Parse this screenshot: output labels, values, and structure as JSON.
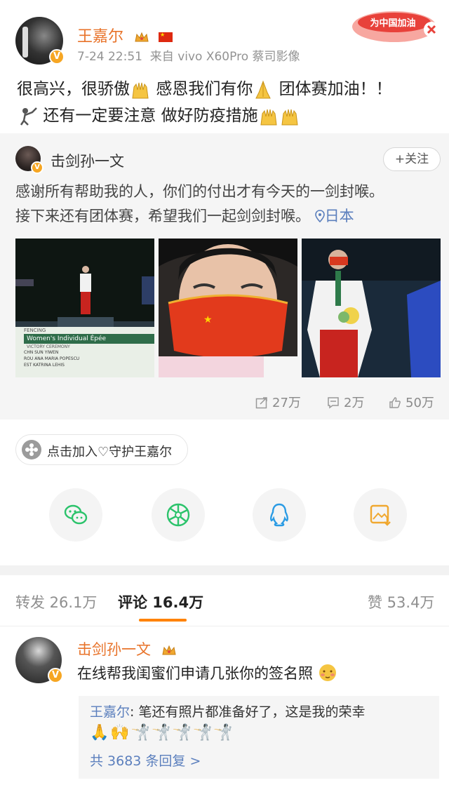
{
  "post": {
    "author": "王嘉尔",
    "time": "7-24 22:51",
    "source": "来自 vivo X60Pro 蔡司影像",
    "text_line1": "很高兴，很骄傲",
    "text_line1b": "感恩我们有你",
    "text_line1c": "团体赛加油！！",
    "text_line2": "还有一定要注意 做好防疫措施",
    "sticker_text": "为中国加油",
    "verify_mark": "V"
  },
  "repost": {
    "author": "击剑孙一文",
    "follow_label": "+关注",
    "text_line1": "感谢所有帮助我的人，你们的付出才有今天的一剑封喉。",
    "text_line2": "接下来还有团体赛，希望我们一起剑剑封喉。",
    "location": "日本",
    "photo1_caption": {
      "tag": "FENCING",
      "title": "Women's Individual Épée",
      "subtitle": "VICTORY CEREMONY",
      "rows": [
        "CHN  SUN YIWEN",
        "ROU  ANA MARIA POPESCU",
        "EST  KATRINA LEHIS"
      ]
    },
    "reposts": "27万",
    "comments": "2万",
    "likes": "50万"
  },
  "guard": {
    "label": "点击加入♡守护王嘉尔"
  },
  "share": {
    "items": [
      "wechat-icon",
      "moments-icon",
      "qq-icon",
      "save-image-icon"
    ]
  },
  "tabs": {
    "repost_label": "转发 26.1万",
    "comment_label": "评论 16.4万",
    "like_label": "赞 53.4万"
  },
  "comment": {
    "author": "击剑孙一文",
    "text": "在线帮我闺蜜们申请几张你的签名照",
    "reply_author": "王嘉尔",
    "reply_text": ": 笔还有照片都准备好了，这是我的荣幸",
    "reply_emojis": "🙏🙌🤺🤺🤺🤺🤺",
    "reply_count": "共 3683 条回复 >"
  },
  "colors": {
    "accent": "#e8732a",
    "link": "#5b7fbd",
    "tab_underline": "#ff8200"
  }
}
